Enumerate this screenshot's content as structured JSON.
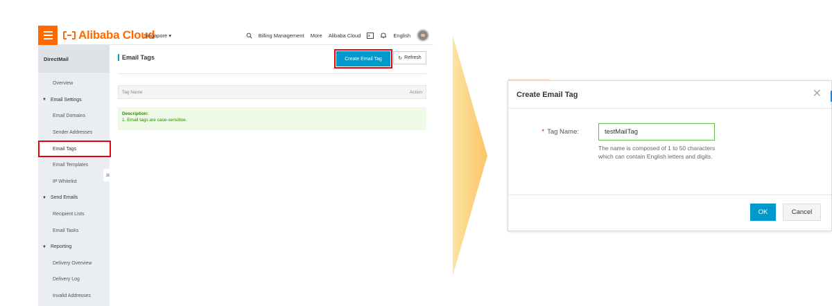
{
  "console": {
    "logo_text": "Alibaba Cloud",
    "region": "Singapore",
    "top_nav": {
      "billing": "Billing Management",
      "more": "More",
      "alibaba_cloud": "Alibaba Cloud",
      "language": "English"
    },
    "sidebar": {
      "title": "DirectMail",
      "items": [
        {
          "label": "Overview",
          "type": "item"
        },
        {
          "label": "Email Settings",
          "type": "group"
        },
        {
          "label": "Email Domains",
          "type": "item"
        },
        {
          "label": "Sender Addresses",
          "type": "item"
        },
        {
          "label": "Email Tags",
          "type": "item",
          "active": true
        },
        {
          "label": "Email Templates",
          "type": "item"
        },
        {
          "label": "IP Whitelist",
          "type": "item"
        },
        {
          "label": "Send Emails",
          "type": "group"
        },
        {
          "label": "Recipient Lists",
          "type": "item"
        },
        {
          "label": "Email Tasks",
          "type": "item"
        },
        {
          "label": "Reporting",
          "type": "group"
        },
        {
          "label": "Delivery Overview",
          "type": "item"
        },
        {
          "label": "Delivery Log",
          "type": "item"
        },
        {
          "label": "Invalid Addresses",
          "type": "item"
        }
      ]
    },
    "main": {
      "title": "Email Tags",
      "create_button": "Create Email Tag",
      "refresh_button": "Refresh",
      "table_headers": {
        "name": "Tag Name",
        "action": "Action"
      },
      "description_title": "Description:",
      "description_text": "1. Email tags are case-sensitive."
    }
  },
  "dialog": {
    "title": "Create Email Tag",
    "field_label": "Tag Name:",
    "field_value": "testMailTag",
    "hint": "The name is composed of 1 to 50 characters which can contain English letters and digits.",
    "ok_button": "OK",
    "cancel_button": "Cancel"
  },
  "colors": {
    "brand_orange": "#ff6a00",
    "primary_blue": "#0099cc",
    "highlight_red": "#e8000b",
    "arrow_yellow": "#fbc56a"
  }
}
